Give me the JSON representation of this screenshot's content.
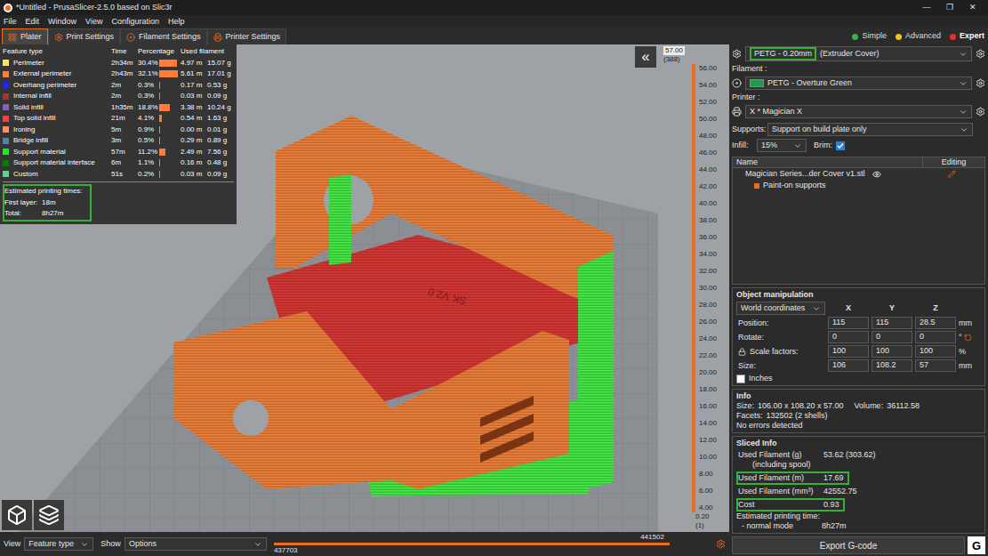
{
  "window": {
    "title": "*Untitled - PrusaSlicer-2.5.0 based on Slic3r",
    "controls": [
      "—",
      "❐",
      "✕"
    ]
  },
  "menu": [
    "File",
    "Edit",
    "Window",
    "View",
    "Configuration",
    "Help"
  ],
  "tabs": [
    {
      "label": "Plater",
      "selected": true
    },
    {
      "label": "Print Settings",
      "selected": false
    },
    {
      "label": "Filament Settings",
      "selected": false
    },
    {
      "label": "Printer Settings",
      "selected": false
    }
  ],
  "modes": [
    {
      "label": "Simple",
      "color": "#3fb04a",
      "selected": false
    },
    {
      "label": "Advanced",
      "color": "#f0c419",
      "selected": false
    },
    {
      "label": "Expert",
      "color": "#e0322f",
      "selected": true
    }
  ],
  "legend": {
    "columns": [
      "Feature type",
      "Time",
      "Percentage",
      "Used filament"
    ],
    "rows": [
      {
        "name": "Perimeter",
        "color": "#ffe64d",
        "time": "2h34m",
        "percentage": "30.4%",
        "level": 0.304,
        "length": "4.97 m",
        "weight": "15.07 g"
      },
      {
        "name": "External perimeter",
        "color": "#ff7d38",
        "time": "2h43m",
        "percentage": "32.1%",
        "level": 0.321,
        "length": "5.61 m",
        "weight": "17.01 g"
      },
      {
        "name": "Overhang perimeter",
        "color": "#1f1fff",
        "time": "2m",
        "percentage": "0.3%",
        "level": 0.003,
        "length": "0.17 m",
        "weight": "0.53 g"
      },
      {
        "name": "Internal infill",
        "color": "#b03029",
        "time": "2m",
        "percentage": "0.3%",
        "level": 0.003,
        "length": "0.03 m",
        "weight": "0.09 g"
      },
      {
        "name": "Solid infill",
        "color": "#9654cc",
        "time": "1h35m",
        "percentage": "18.8%",
        "level": 0.188,
        "length": "3.38 m",
        "weight": "10.24 g"
      },
      {
        "name": "Top solid infill",
        "color": "#f04040",
        "time": "21m",
        "percentage": "4.1%",
        "level": 0.041,
        "length": "0.54 m",
        "weight": "1.63 g"
      },
      {
        "name": "Ironing",
        "color": "#ff8c69",
        "time": "5m",
        "percentage": "0.9%",
        "level": 0.009,
        "length": "0.00 m",
        "weight": "0.01 g"
      },
      {
        "name": "Bridge infill",
        "color": "#4d80ba",
        "time": "3m",
        "percentage": "0.5%",
        "level": 0.005,
        "length": "0.29 m",
        "weight": "0.89 g"
      },
      {
        "name": "Support material",
        "color": "#00ff00",
        "time": "57m",
        "percentage": "11.2%",
        "level": 0.112,
        "length": "2.49 m",
        "weight": "7.56 g"
      },
      {
        "name": "Support material interface",
        "color": "#008000",
        "time": "6m",
        "percentage": "1.1%",
        "level": 0.011,
        "length": "0.16 m",
        "weight": "0.48 g"
      },
      {
        "name": "Custom",
        "color": "#5ed194",
        "time": "51s",
        "percentage": "0.2%",
        "level": 0.002,
        "length": "0.03 m",
        "weight": "0.09 g"
      }
    ],
    "estimates": {
      "title": "Estimated printing times:",
      "highlighted": true,
      "rows": [
        {
          "label": "First layer:",
          "value": "18m"
        },
        {
          "label": "Total:",
          "value": "8h27m"
        }
      ]
    }
  },
  "viewport": {
    "collapse": "«",
    "model_label": "SK V2.0"
  },
  "vertical_slider": {
    "top_value": "57.00",
    "top_layer": "(388)",
    "ticks": [
      "56.00",
      "54.00",
      "52.00",
      "50.00",
      "48.00",
      "46.00",
      "44.00",
      "42.00",
      "40.00",
      "38.00",
      "36.00",
      "34.00",
      "32.00",
      "30.00",
      "28.00",
      "26.00",
      "24.00",
      "22.00",
      "20.00",
      "18.00",
      "16.00",
      "14.00",
      "12.00",
      "10.00",
      "8.00",
      "6.00",
      "4.00"
    ],
    "bottom_value": "0.20",
    "bottom_layer": "(1)",
    "upper_level": 1,
    "lower_level": 0
  },
  "bottom_bar": {
    "view_label": "View",
    "view_value": "Feature type",
    "show_label": "Show",
    "show_value": "Options",
    "slider": {
      "upper": "441502",
      "lower": "437703",
      "upper_level": 1,
      "lower_level": 0
    }
  },
  "sidebar": {
    "print_preset": {
      "highlighted_text": "PETG - 0.20mm",
      "rest": "(Extruder Cover)",
      "highlighted": true
    },
    "filament": {
      "label": "Filament :",
      "value": "PETG - Overture Green",
      "color": "#1f9a4a"
    },
    "printer": {
      "label": "Printer :",
      "value": "X * Magician X"
    },
    "supports": {
      "label": "Supports:",
      "value": "Support on build plate only"
    },
    "infill": {
      "label": "Infill:",
      "value": "15%"
    },
    "brim": {
      "label": "Brim:",
      "checked": true
    },
    "object_list": {
      "columns": [
        "Name",
        "Editing"
      ],
      "objects": [
        {
          "name": "Magician Series...der Cover v1.stl",
          "visible": true,
          "children": [
            "Paint-on supports"
          ]
        }
      ]
    },
    "manipulation": {
      "title": "Object manipulation",
      "coordinates": "World coordinates",
      "axes": [
        "X",
        "Y",
        "Z"
      ],
      "rows": [
        {
          "label": "Position:",
          "values": [
            "115",
            "115",
            "28.5"
          ],
          "unit": "mm",
          "locked": false,
          "reset": false
        },
        {
          "label": "Rotate:",
          "values": [
            "0",
            "0",
            "0"
          ],
          "unit": "°",
          "locked": false,
          "reset": true
        },
        {
          "label": "Scale factors:",
          "values": [
            "100",
            "100",
            "100"
          ],
          "unit": "%",
          "locked": true,
          "reset": false
        },
        {
          "label": "Size:",
          "values": [
            "106",
            "108.2",
            "57"
          ],
          "unit": "mm",
          "locked": false,
          "reset": false
        }
      ],
      "inches": {
        "label": "Inches",
        "checked": false
      }
    },
    "info": {
      "title": "Info",
      "lines": [
        [
          {
            "label": "Size:",
            "value": "106.00 x 108.20 x 57.00"
          },
          {
            "label": "Volume:",
            "value": "36112.58"
          }
        ],
        [
          {
            "label": "Facets:",
            "value": "132502 (2 shells)"
          }
        ]
      ],
      "status": "No errors detected"
    },
    "sliced": {
      "title": "Sliced Info",
      "rows": [
        {
          "label": "Used Filament (g)",
          "sublabel": "(including spool)",
          "value": "53.62 (303.62)",
          "highlighted": false
        },
        {
          "label": "Used Filament (m)",
          "sublabel": "",
          "value": "17.69",
          "highlighted": true
        },
        {
          "label": "Used Filament (mm³)",
          "sublabel": "",
          "value": "42552.75",
          "highlighted": false
        },
        {
          "label": "Cost",
          "sublabel": "",
          "value": "0.93",
          "highlighted": true
        }
      ],
      "estimate": {
        "label": "Estimated printing time:",
        "mode": "- normal mode",
        "value": "8h27m"
      }
    },
    "export": {
      "label": "Export G-code",
      "icon": "G"
    }
  }
}
